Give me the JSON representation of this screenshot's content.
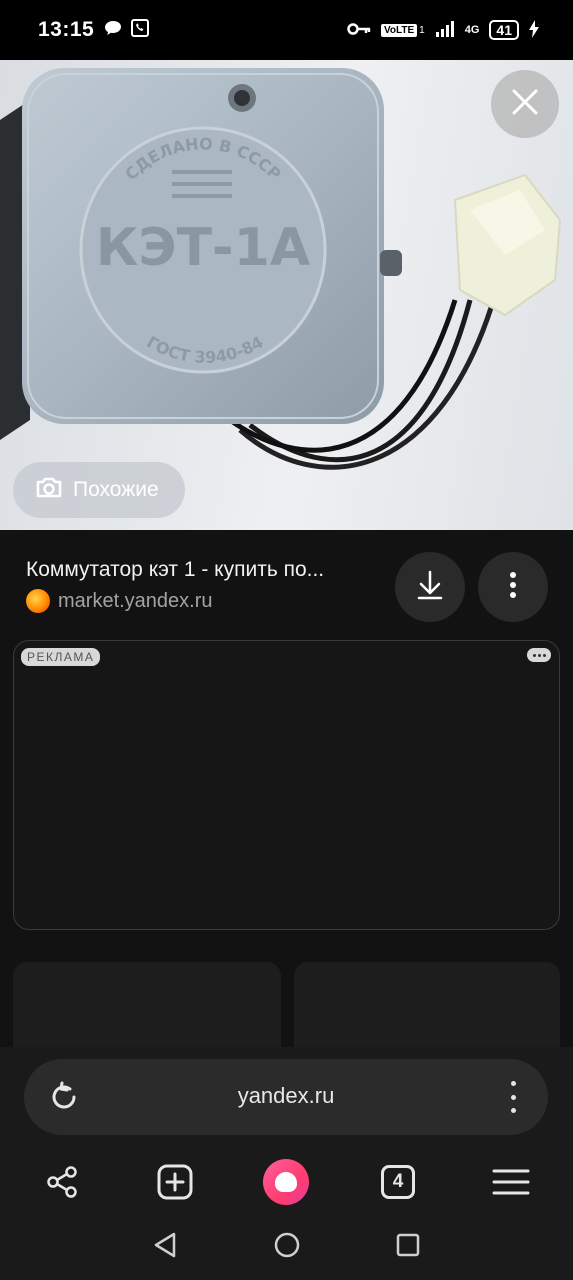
{
  "status_bar": {
    "time": "13:15",
    "left_icons": [
      "chat-bubble-icon",
      "phone-wifi-icon"
    ],
    "right_icons": [
      "key-icon",
      "volte-icon",
      "signal-icon",
      "4g-icon"
    ],
    "volte_label": "VoLTE",
    "sim_label": "1",
    "network_label": "4G",
    "battery_level": "41"
  },
  "photo": {
    "device_text_top": "СДЕЛАНО В СССР",
    "device_model": "КЭТ-1А",
    "device_standard": "ГОСТ 3940-84",
    "similar_label": "Похожие"
  },
  "result": {
    "title": "Коммутатор кэт 1 - купить по...",
    "source": "market.yandex.ru"
  },
  "ad": {
    "badge": "РЕКЛАМА"
  },
  "browser": {
    "url": "yandex.ru",
    "tabs_count": "4"
  },
  "colors": {
    "background": "#121212",
    "alice_accent": "#ff3d6f",
    "panel": "#1a1a1a"
  }
}
